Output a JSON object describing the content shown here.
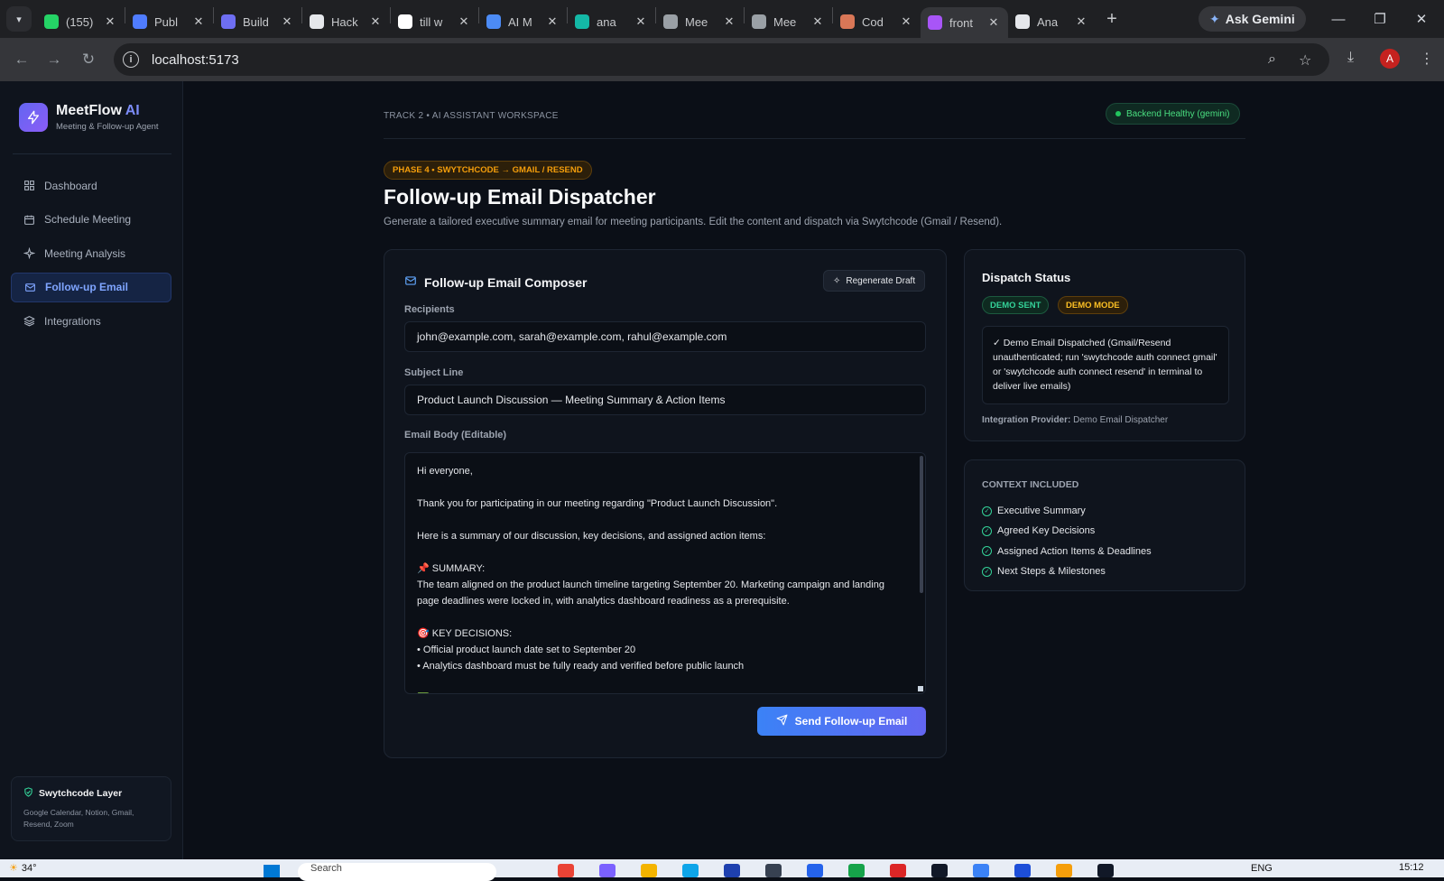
{
  "browser": {
    "tabs": [
      {
        "label": "(155)",
        "icon": "whatsapp-icon",
        "color": "#25d366"
      },
      {
        "label": "Publ",
        "icon": "publ-icon",
        "color": "#4f7cff"
      },
      {
        "label": "Build",
        "icon": "build-icon",
        "color": "#6e6ef2"
      },
      {
        "label": "Hack",
        "icon": "openai-icon",
        "color": "#e5e7eb"
      },
      {
        "label": "till w",
        "icon": "google-icon",
        "color": "#ffffff"
      },
      {
        "label": "AI M",
        "icon": "gemini-icon",
        "color": "#4c8bf5"
      },
      {
        "label": "ana",
        "icon": "diamond-icon",
        "color": "#14b8a6"
      },
      {
        "label": "Mee",
        "icon": "globe-icon",
        "color": "#9aa0a6"
      },
      {
        "label": "Mee",
        "icon": "globe-icon",
        "color": "#9aa0a6"
      },
      {
        "label": "Cod",
        "icon": "claude-icon",
        "color": "#d97757"
      },
      {
        "label": "front",
        "icon": "vite-icon",
        "color": "#a855f7"
      },
      {
        "label": "Ana",
        "icon": "github-icon",
        "color": "#e5e7eb"
      }
    ],
    "active_tab_index": 10,
    "ask_gemini": "Ask Gemini",
    "url": "localhost:5173",
    "profile_initial": "A"
  },
  "sidebar": {
    "brand": "MeetFlow",
    "brand_accent": "AI",
    "brand_sub": "Meeting & Follow-up Agent",
    "items": [
      {
        "label": "Dashboard",
        "icon": "grid-icon"
      },
      {
        "label": "Schedule Meeting",
        "icon": "calendar-icon"
      },
      {
        "label": "Meeting Analysis",
        "icon": "sparkles-icon"
      },
      {
        "label": "Follow-up Email",
        "icon": "mail-icon"
      },
      {
        "label": "Integrations",
        "icon": "layers-icon"
      }
    ],
    "active_index": 3,
    "layer_card": {
      "title": "Swytchcode Layer",
      "desc": "Google Calendar, Notion, Gmail, Resend, Zoom"
    }
  },
  "header": {
    "track": "TRACK 2 • AI ASSISTANT WORKSPACE",
    "health": "Backend Healthy (gemini)",
    "phase": "PHASE 4 • SWYTCHCODE → GMAIL / RESEND",
    "title": "Follow-up Email Dispatcher",
    "subtitle": "Generate a tailored executive summary email for meeting participants. Edit the content and dispatch via Swytchcode (Gmail / Resend)."
  },
  "composer": {
    "title": "Follow-up Email Composer",
    "regen": "Regenerate Draft",
    "recipients_label": "Recipients",
    "recipients": "john@example.com, sarah@example.com, rahul@example.com",
    "subject_label": "Subject Line",
    "subject": "Product Launch Discussion — Meeting Summary & Action Items",
    "body_label": "Email Body (Editable)",
    "body": "Hi everyone,\n\nThank you for participating in our meeting regarding \"Product Launch Discussion\".\n\nHere is a summary of our discussion, key decisions, and assigned action items:\n\n📌 SUMMARY:\nThe team aligned on the product launch timeline targeting September 20. Marketing campaign and landing page deadlines were locked in, with analytics dashboard readiness as a prerequisite.\n\n🎯 KEY DECISIONS:\n• Official product launch date set to September 20\n• Analytics dashboard must be fully ready and verified before public launch\n\n✅ ACTION ITEMS:",
    "send": "Send Follow-up Email"
  },
  "dispatch": {
    "title": "Dispatch Status",
    "badge_sent": "DEMO SENT",
    "badge_mode": "DEMO MODE",
    "message": "✓ Demo Email Dispatched (Gmail/Resend unauthenticated; run 'swytchcode auth connect gmail' or 'swytchcode auth connect resend' in terminal to deliver live emails)",
    "provider_label": "Integration Provider:",
    "provider_value": "Demo Email Dispatcher"
  },
  "context": {
    "title": "CONTEXT INCLUDED",
    "items": [
      "Executive Summary",
      "Agreed Key Decisions",
      "Assigned Action Items & Deadlines",
      "Next Steps & Milestones"
    ]
  },
  "taskbar": {
    "weather": "34°",
    "search_placeholder": "Search",
    "lang": "ENG",
    "time": "15:12"
  }
}
